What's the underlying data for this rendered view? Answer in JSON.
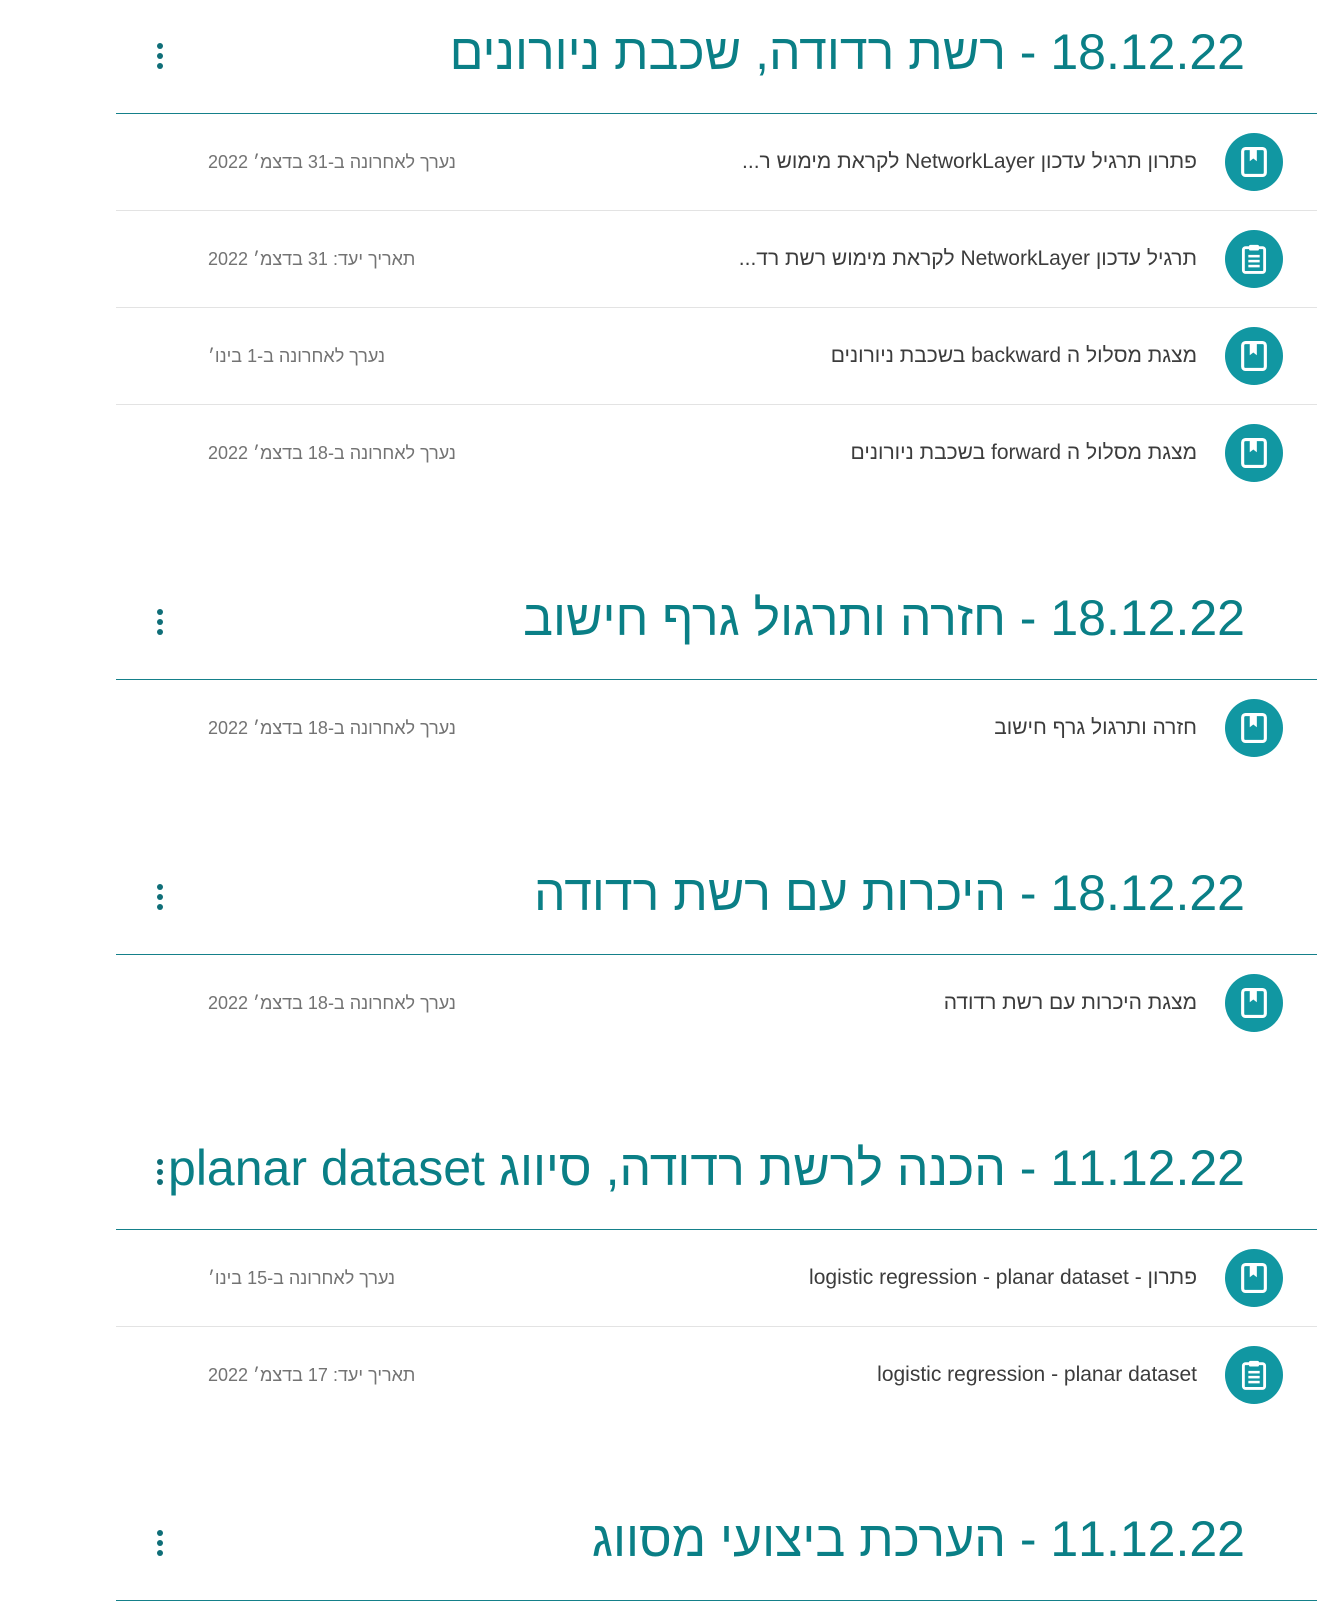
{
  "topics": [
    {
      "title": "18.12.22 - רשת רדודה, שכבת ניורונים",
      "items": [
        {
          "icon": "material-icon",
          "title": "פתרון תרגיל עדכון NetworkLayer לקראת מימוש ר...",
          "meta": "נערך לאחרונה ב-31 בדצמ׳ 2022"
        },
        {
          "icon": "assignment-icon",
          "title": "תרגיל עדכון NetworkLayer לקראת מימוש רשת רד...",
          "meta": "תאריך יעד: 31 בדצמ׳ 2022"
        },
        {
          "icon": "material-icon",
          "title": "מצגת מסלול ה backward בשכבת ניורונים",
          "meta": "נערך לאחרונה ב-1 בינו׳"
        },
        {
          "icon": "material-icon",
          "title": "מצגת מסלול ה forward בשכבת ניורונים",
          "meta": "נערך לאחרונה ב-18 בדצמ׳ 2022"
        }
      ]
    },
    {
      "title": "18.12.22 - חזרה ותרגול גרף חישוב",
      "items": [
        {
          "icon": "material-icon",
          "title": "חזרה ותרגול גרף חישוב",
          "meta": "נערך לאחרונה ב-18 בדצמ׳ 2022"
        }
      ]
    },
    {
      "title": "18.12.22 - היכרות עם רשת רדודה",
      "items": [
        {
          "icon": "material-icon",
          "title": "מצגת היכרות עם רשת רדודה",
          "meta": "נערך לאחרונה ב-18 בדצמ׳ 2022"
        }
      ]
    },
    {
      "title": "11.12.22 - הכנה לרשת רדודה, סיווג planar dataset",
      "items": [
        {
          "icon": "material-icon",
          "title": "פתרון - logistic regression - planar dataset",
          "meta": "נערך לאחרונה ב-15 בינו׳"
        },
        {
          "icon": "assignment-icon",
          "title": "logistic regression - planar dataset",
          "meta": "תאריך יעד: 17 בדצמ׳ 2022"
        }
      ]
    },
    {
      "title": "11.12.22 - הערכת ביצועי מסווג",
      "items": []
    }
  ],
  "colors": {
    "accent": "#0a7f86",
    "icon_bg": "#1197a2",
    "divider": "#15808a"
  }
}
